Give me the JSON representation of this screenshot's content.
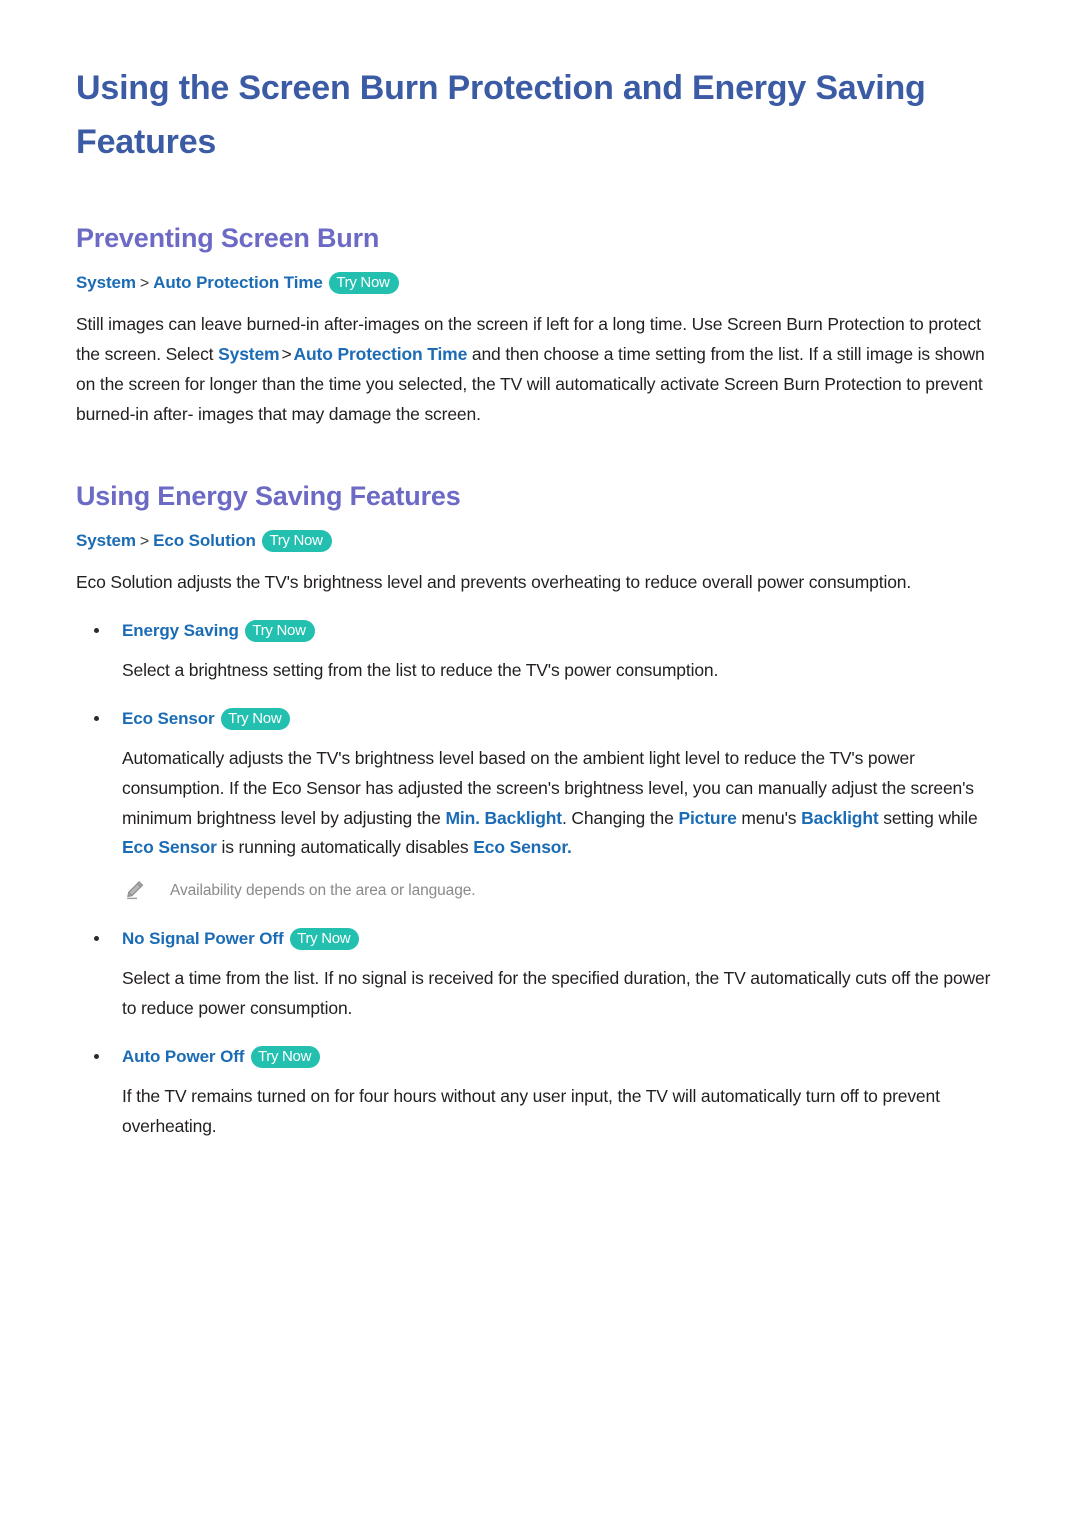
{
  "document": {
    "title_line1": "Using the Screen Burn Protection and Energy Saving",
    "title_line2": "Features"
  },
  "colors": {
    "title": "#3B5BA5",
    "section_heading": "#6D6AC6",
    "link": "#1B6CB5",
    "badge_background": "#23C0B0",
    "badge_text": "#FFFFFF",
    "body_text": "#231F20",
    "note_text": "#8A8A8A",
    "page_background": "#FFFFFF"
  },
  "sections": [
    {
      "heading": "Preventing Screen Burn",
      "breadcrumb": {
        "root": "System",
        "separator": ">",
        "leaf": "Auto Protection Time",
        "badge": "Try Now"
      },
      "paragraph": {
        "part1": "Still images can leave burned-in after-images on the screen if left for a long time. Use Screen Burn Protection to protect the screen. Select ",
        "link1": "System",
        "sep1": ">",
        "link2": "Auto Protection Time",
        "part2": " and then choose a time setting from the list. If a still image is shown on the screen for longer than the time you selected, the TV will automatically activate Screen Burn Protection to prevent burned-in after- images that may damage the screen."
      }
    },
    {
      "heading": "Using Energy Saving Features",
      "breadcrumb": {
        "root": "System",
        "separator": ">",
        "leaf": "Eco Solution",
        "badge": "Try Now"
      },
      "paragraph": {
        "part1": "Eco Solution adjusts the TV's brightness level and prevents overheating to reduce overall power consumption."
      }
    }
  ],
  "bullets": [
    {
      "label": "Energy Saving",
      "badge": "Try Now",
      "body": "Select a brightness setting from the list to reduce the TV's power consumption."
    },
    {
      "label": "Eco Sensor",
      "badge": "Try Now",
      "body_part1": "Automatically adjusts the TV's brightness level based on the ambient light level to reduce the TV's power consumption. If the Eco Sensor has adjusted the screen's brightness level, you can manually adjust the screen's minimum brightness level by adjusting the ",
      "body_link1": "Min. Backlight",
      "body_part2": ". Changing the ",
      "body_link2": "Picture",
      "body_part3": " menu's ",
      "body_link3": "Backlight",
      "body_part4": " setting while ",
      "body_link4": "Eco Sensor",
      "body_part5": " is running automatically disables ",
      "body_link5": "Eco Sensor",
      "body_part6": ".",
      "note": "Availability depends on the area or language.",
      "note_icon": "pencil-icon"
    },
    {
      "label": "No Signal Power Off",
      "badge": "Try Now",
      "body": "Select a time from the list. If no signal is received for the specified duration, the TV automatically cuts off the power to reduce power consumption."
    },
    {
      "label": "Auto Power Off",
      "badge": "Try Now",
      "body": "If the TV remains turned on for four hours without any user input, the TV will automatically turn off to prevent overheating."
    }
  ]
}
